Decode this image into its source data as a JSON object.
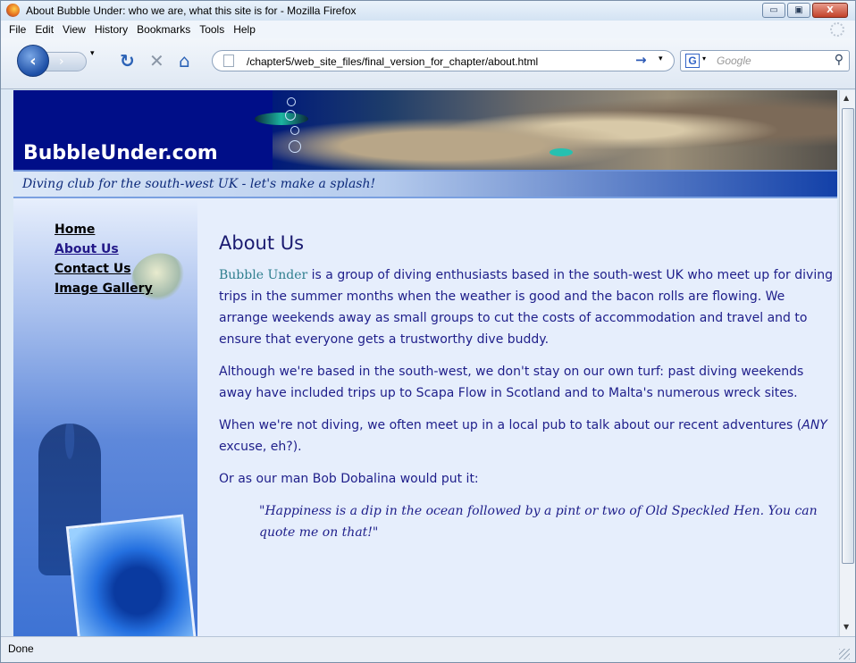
{
  "window": {
    "title": "About Bubble Under: who we are, what this site is for - Mozilla Firefox",
    "minimize_label": "▭",
    "maximize_label": "▣",
    "close_label": "X"
  },
  "menu": [
    "File",
    "Edit",
    "View",
    "History",
    "Bookmarks",
    "Tools",
    "Help"
  ],
  "toolbar": {
    "back_icon": "back-arrow-icon",
    "forward_icon": "forward-arrow-icon",
    "url": "/chapter5/web_site_files/final_version_for_chapter/about.html",
    "search_placeholder": "Google",
    "search_engine_letter": "G"
  },
  "site": {
    "name": "BubbleUnder.com",
    "tagline": "Diving club for the south-west UK - let's make a splash!",
    "nav": [
      "Home",
      "About Us",
      "Contact Us",
      "Image Gallery"
    ]
  },
  "content": {
    "heading": "About Us",
    "p1_brand": "Bubble Under",
    "p1_rest": " is a group of diving enthusiasts based in the south-west UK who meet up for diving trips in the summer months when the weather is good and the bacon rolls are flowing. We arrange weekends away as small groups to cut the costs of accommodation and travel and to ensure that everyone gets a trustworthy dive buddy.",
    "p2": "Although we're based in the south-west, we don't stay on our own turf: past diving weekends away have included trips up to Scapa Flow in Scotland and to Malta's numerous wreck sites.",
    "p3_a": "When we're not diving, we often meet up in a local pub to talk about our recent adventures (",
    "p3_em": "ANY",
    "p3_b": " excuse, eh?).",
    "p4": "Or as our man Bob Dobalina would put it:",
    "quote": "\"Happiness is a dip in the ocean followed by a pint or two of Old Speckled Hen. You can quote me on that!\""
  },
  "status": "Done",
  "colors": {
    "header_bg": "#000e88",
    "text": "#1e1e8a",
    "brand": "#2f7f8f",
    "page_bg": "#e6eefc"
  }
}
